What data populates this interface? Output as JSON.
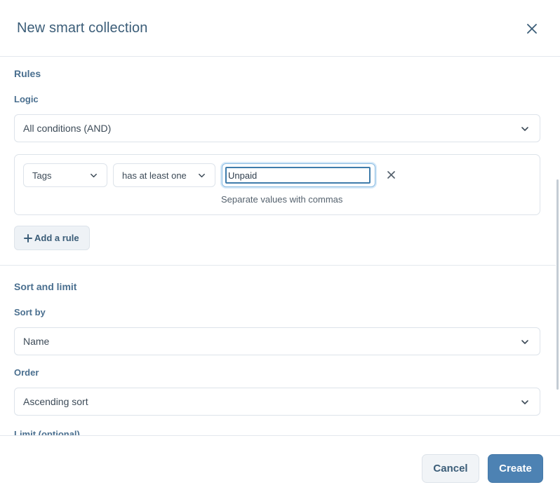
{
  "dialog": {
    "title": "New smart collection",
    "close_icon": "close-icon"
  },
  "rules": {
    "section_title": "Rules",
    "logic_label": "Logic",
    "logic_value": "All conditions (AND)",
    "rule": {
      "field": "Tags",
      "operator": "has at least one",
      "value": "Unpaid",
      "hint": "Separate values with commas",
      "remove_icon": "close-icon"
    },
    "add_rule_icon": "plus-icon",
    "add_rule_label": "Add a rule"
  },
  "sort": {
    "section_title": "Sort and limit",
    "sort_by_label": "Sort by",
    "sort_by_value": "Name",
    "order_label": "Order",
    "order_value": "Ascending sort",
    "limit_label": "Limit (optional)"
  },
  "footer": {
    "cancel_label": "Cancel",
    "create_label": "Create"
  },
  "colors": {
    "accent": "#4d82b3",
    "title": "#3b5d78",
    "label": "#4a6f8f",
    "focus_border": "#3f7cab"
  }
}
